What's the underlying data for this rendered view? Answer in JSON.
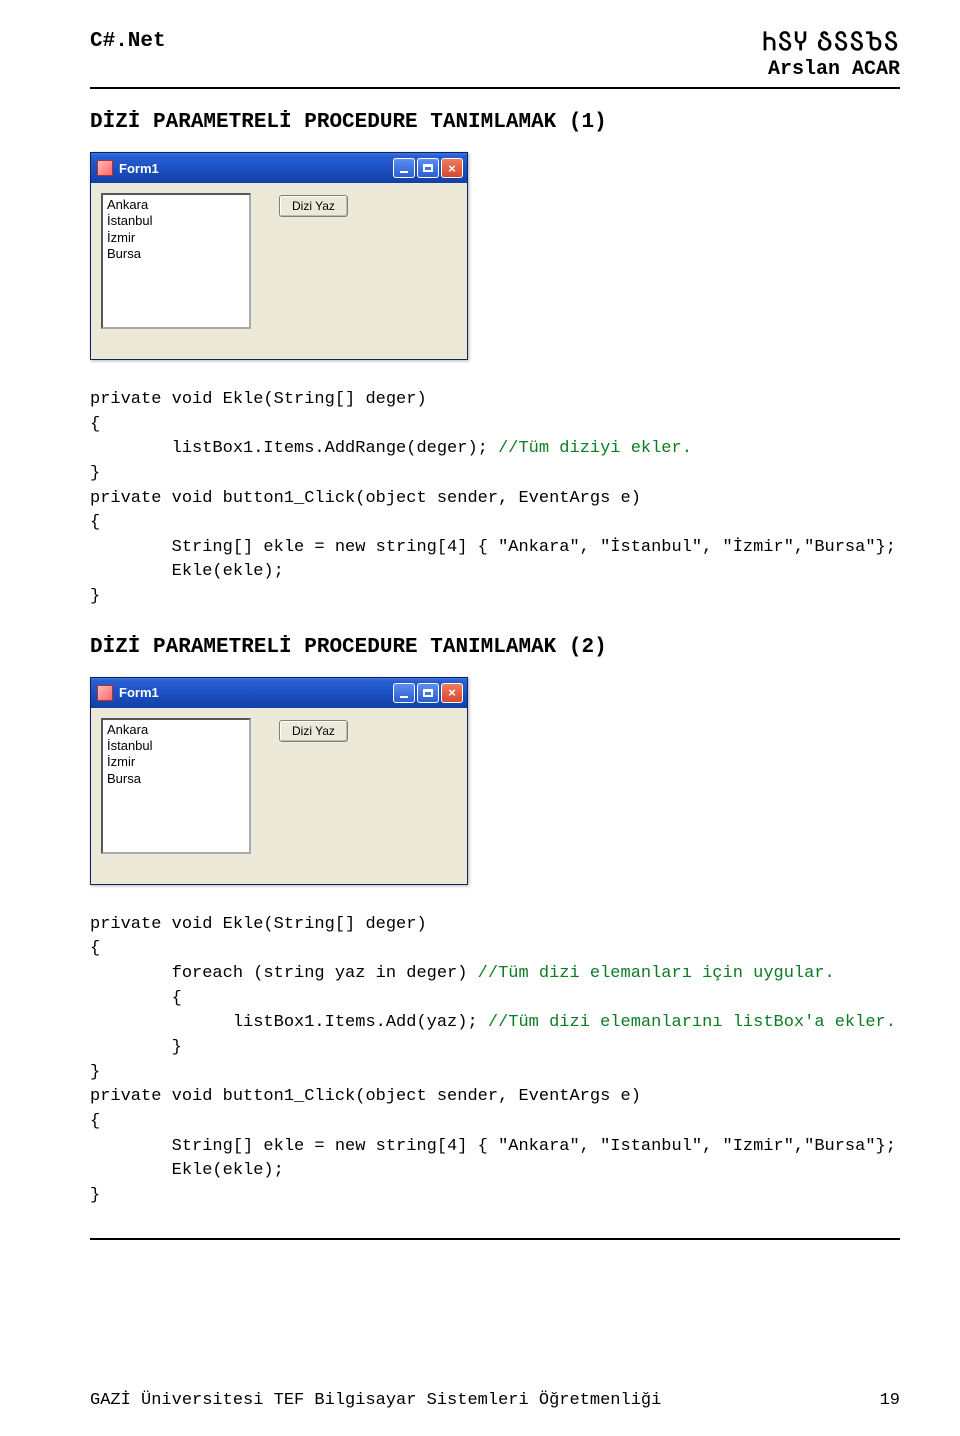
{
  "header": {
    "left": "C#.Net",
    "decor": "ႹႽჄ ჂႽႽႦႽ",
    "author": "Arslan ACAR"
  },
  "section1_title": "DİZİ PARAMETRELİ PROCEDURE TANIMLAMAK (1)",
  "section2_title": "DİZİ PARAMETRELİ PROCEDURE TANIMLAMAK (2)",
  "form": {
    "title": "Form1",
    "button_label": "Dizi Yaz",
    "list_items": [
      "Ankara",
      "İstanbul",
      "İzmir",
      "Bursa"
    ]
  },
  "code1": {
    "line1": "private void Ekle(String[] deger)",
    "line2": "{",
    "line3a": "        listBox1.Items.AddRange(deger); ",
    "line3b": "//Tüm diziyi ekler.",
    "line4": "}",
    "line5": "private void button1_Click(object sender, EventArgs e)",
    "line6": "{",
    "line7": "        String[] ekle = new string[4] { \"Ankara\", \"İstanbul\", \"İzmir\",\"Bursa\"};",
    "line8": "        Ekle(ekle);",
    "line9": "}"
  },
  "code2": {
    "line1": "private void Ekle(String[] deger)",
    "line2": "{",
    "line3a": "        foreach (string yaz in deger) ",
    "line3b": "//Tüm dizi elemanları için uygular.",
    "line4": "        {",
    "line5a": "              listBox1.Items.Add(yaz); ",
    "line5b": "//Tüm dizi elemanlarını listBox'a ekler.",
    "line6": "        }",
    "line7": "}",
    "line8": "private void button1_Click(object sender, EventArgs e)",
    "line9": "{",
    "line10": "        String[] ekle = new string[4] { \"Ankara\", \"Istanbul\", \"Izmir\",\"Bursa\"};",
    "line11": "        Ekle(ekle);",
    "line12": "}"
  },
  "footer": {
    "left": "GAZİ Üniversitesi TEF Bilgisayar Sistemleri Öğretmenliği",
    "page": "19"
  }
}
